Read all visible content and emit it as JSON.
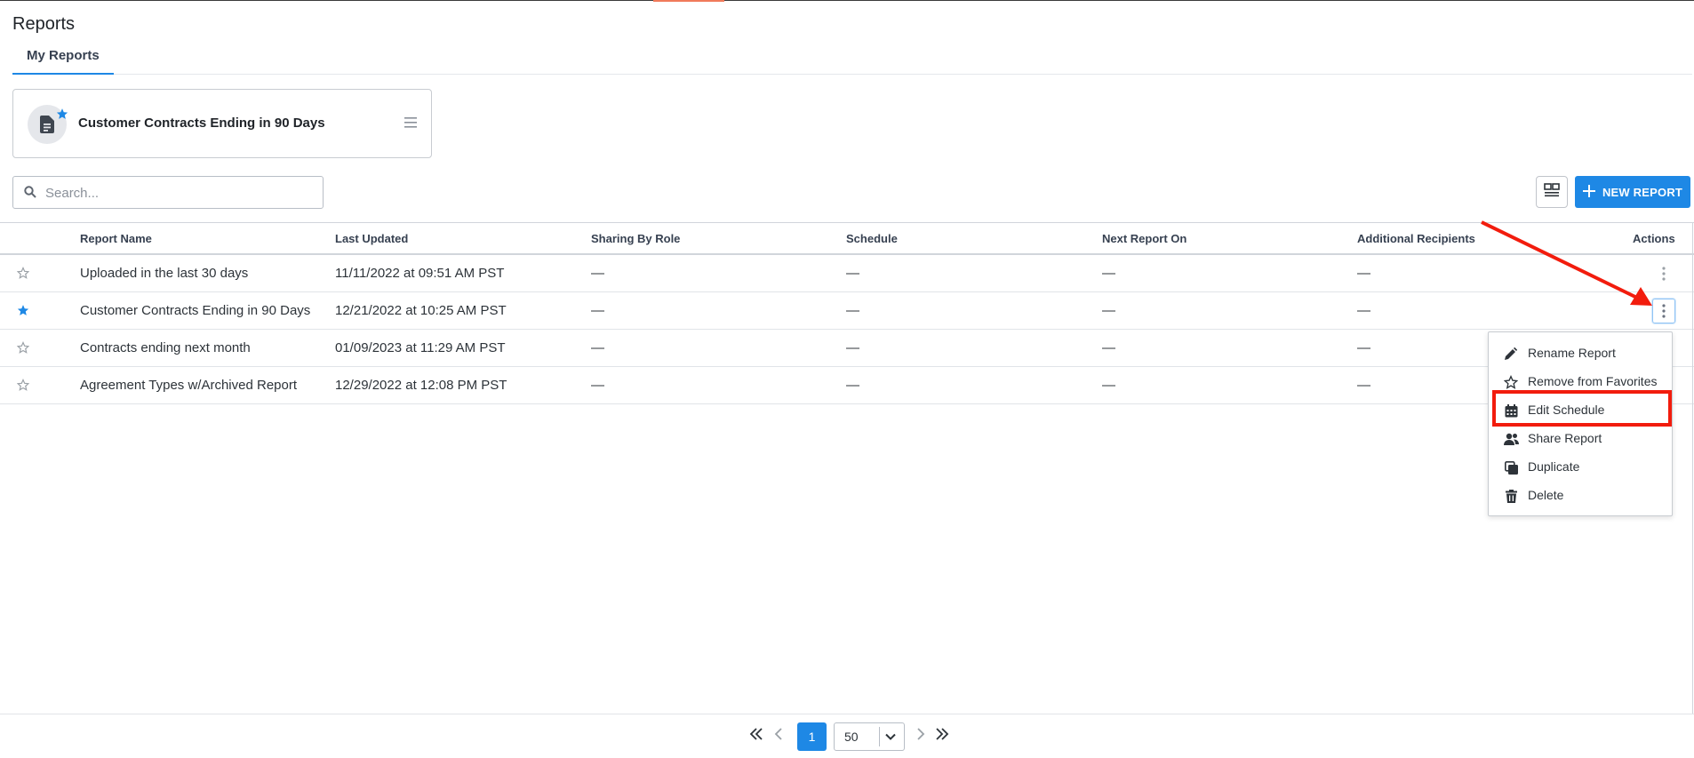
{
  "page": {
    "title": "Reports"
  },
  "tabs": [
    {
      "label": "My Reports",
      "active": true
    }
  ],
  "favorite_card": {
    "title": "Customer Contracts Ending in 90 Days",
    "icon": "document-icon",
    "favorited": true
  },
  "search": {
    "placeholder": "Search...",
    "value": ""
  },
  "toolbar": {
    "new_report_label": "NEW REPORT"
  },
  "table": {
    "columns": [
      "Report Name",
      "Last Updated",
      "Sharing By Role",
      "Schedule",
      "Next Report On",
      "Additional Recipients",
      "Actions"
    ],
    "rows": [
      {
        "favorite": false,
        "name": "Uploaded in the last 30 days",
        "last_updated": "11/11/2022 at 09:51 AM PST",
        "sharing": "—",
        "schedule": "—",
        "next_report": "—",
        "recipients": "—"
      },
      {
        "favorite": true,
        "name": "Customer Contracts Ending in 90 Days",
        "last_updated": "12/21/2022 at 10:25 AM PST",
        "sharing": "—",
        "schedule": "—",
        "next_report": "—",
        "recipients": "—"
      },
      {
        "favorite": false,
        "name": "Contracts ending next month",
        "last_updated": "01/09/2023 at 11:29 AM PST",
        "sharing": "—",
        "schedule": "—",
        "next_report": "—",
        "recipients": "—"
      },
      {
        "favorite": false,
        "name": "Agreement Types w/Archived Report",
        "last_updated": "12/29/2022 at 12:08 PM PST",
        "sharing": "—",
        "schedule": "—",
        "next_report": "—",
        "recipients": "—"
      }
    ]
  },
  "actions_menu": {
    "items": [
      {
        "label": "Rename Report",
        "icon": "pencil-icon"
      },
      {
        "label": "Remove from Favorites",
        "icon": "star-outline-icon"
      },
      {
        "label": "Edit Schedule",
        "icon": "calendar-icon",
        "highlighted": true
      },
      {
        "label": "Share Report",
        "icon": "users-icon"
      },
      {
        "label": "Duplicate",
        "icon": "copy-icon"
      },
      {
        "label": "Delete",
        "icon": "trash-icon"
      }
    ]
  },
  "pagination": {
    "current_page": "1",
    "page_size": "50"
  },
  "colors": {
    "accent": "#1e88e5",
    "annotation": "#f21c0d",
    "star_active": "#1e88e5",
    "star_inactive": "#9aa0a6"
  }
}
